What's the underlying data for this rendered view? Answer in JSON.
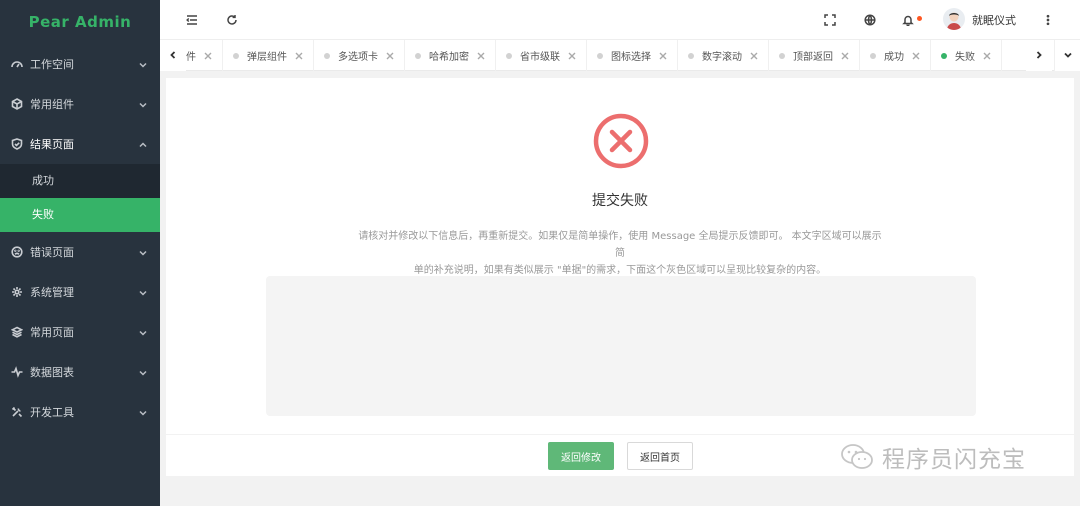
{
  "app": {
    "title": "Pear Admin"
  },
  "sidebar": {
    "items": [
      {
        "label": "工作空间",
        "icon": "dashboard-icon"
      },
      {
        "label": "常用组件",
        "icon": "cube-icon"
      },
      {
        "label": "结果页面",
        "icon": "shield-icon",
        "open": true,
        "children": [
          {
            "label": "成功"
          },
          {
            "label": "失败",
            "active": true
          }
        ]
      },
      {
        "label": "错误页面",
        "icon": "sad-face-icon"
      },
      {
        "label": "系统管理",
        "icon": "gear-icon"
      },
      {
        "label": "常用页面",
        "icon": "layers-icon"
      },
      {
        "label": "数据图表",
        "icon": "pulse-icon"
      },
      {
        "label": "开发工具",
        "icon": "tools-icon"
      }
    ]
  },
  "header": {
    "icons": [
      "menu-fold-icon",
      "refresh-icon",
      "fullscreen-icon",
      "globe-icon",
      "bell-icon",
      "more-icon"
    ],
    "username": "就眠仪式"
  },
  "tabs": [
    {
      "label": "件",
      "partial": true
    },
    {
      "label": "弹层组件"
    },
    {
      "label": "多选项卡"
    },
    {
      "label": "哈希加密"
    },
    {
      "label": "省市级联"
    },
    {
      "label": "图标选择"
    },
    {
      "label": "数字滚动"
    },
    {
      "label": "顶部返回"
    },
    {
      "label": "成功"
    },
    {
      "label": "失败",
      "active": true
    }
  ],
  "result": {
    "title": "提交失败",
    "desc_line1": "请核对并修改以下信息后，再重新提交。如果仅是简单操作，使用 Message 全局提示反馈即可。 本文字区域可以展示简",
    "desc_line2": "单的补充说明，如果有类似展示 \"单据\"的需求，下面这个灰色区域可以呈现比较复杂的内容。",
    "primary_button": "返回修改",
    "secondary_button": "返回首页"
  },
  "colors": {
    "accent": "#36b368",
    "error": "#ec6e6e",
    "sidebar_bg": "#28333e"
  },
  "watermark": {
    "text": "程序员闪充宝"
  }
}
